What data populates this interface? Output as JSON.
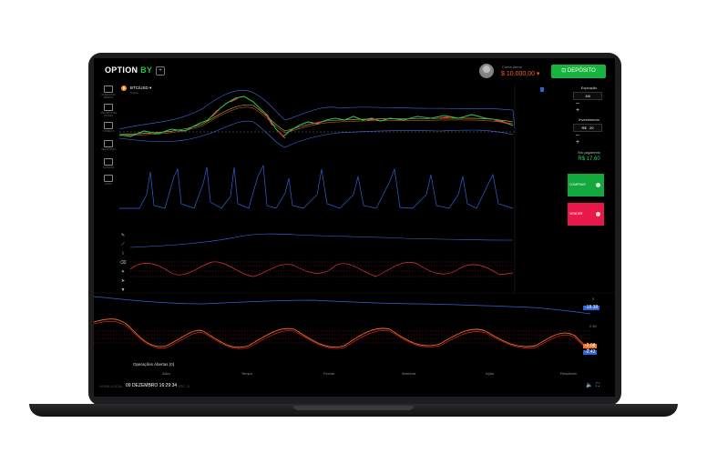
{
  "app": {
    "logo_main": "OPTION",
    "logo_accent": "BY",
    "account_label": "Conta demo",
    "balance": "$ 10.000,00",
    "deposit_label": "DEPÓSITO",
    "brand_green": "#17b43f",
    "sell_red": "#e8184a",
    "balance_orange": "#ff5a2a"
  },
  "sidebar": {
    "items": [
      {
        "icon": "monitor-icon",
        "label": "OPERAÇÕES ABERTAS"
      },
      {
        "icon": "history-icon",
        "label": "HISTÓRICO DE TRADES"
      },
      {
        "icon": "clock-icon",
        "label": "TORNEIOS"
      },
      {
        "icon": "shield-icon",
        "label": "SEGURANÇA"
      },
      {
        "icon": "chat-icon",
        "label": "SUPORTE"
      },
      {
        "icon": "headset-icon",
        "label": "AJUDA"
      }
    ]
  },
  "asset": {
    "icon": "bitcoin-icon",
    "name": "BTC/USD",
    "sub": "Crypto"
  },
  "trade_panel": {
    "expiry_label": "Expiração",
    "expiry_value": "1M",
    "investment_label": "Investimento",
    "currency": "R$",
    "investment_value": "20",
    "payout_label": "Seu pagamento",
    "payout_value": "R$ 17,60",
    "buy_label": "COMPRAR",
    "sell_label": "VENDER"
  },
  "tools": [
    "pencil-icon",
    "line-icon",
    "brush-icon",
    "eraser-icon",
    "magic-icon",
    "cursor-icon",
    "vote-icon"
  ],
  "indicator_tags": {
    "macd_blue": "-18.38",
    "rsi_orange": "-2.08",
    "rsi_blue": "-2.42",
    "macd_zero": "0",
    "level": "2.50"
  },
  "operations": {
    "title": "Operações Abertas (0)",
    "columns": [
      "Ativo",
      "Tempo",
      "Fechar",
      "Abertura",
      "Ação",
      "Resultado"
    ]
  },
  "footer": {
    "label": "HORA LOCAL",
    "clock": "09 DEZEMBRO 16:29:34",
    "utc": "UTC -3"
  }
}
